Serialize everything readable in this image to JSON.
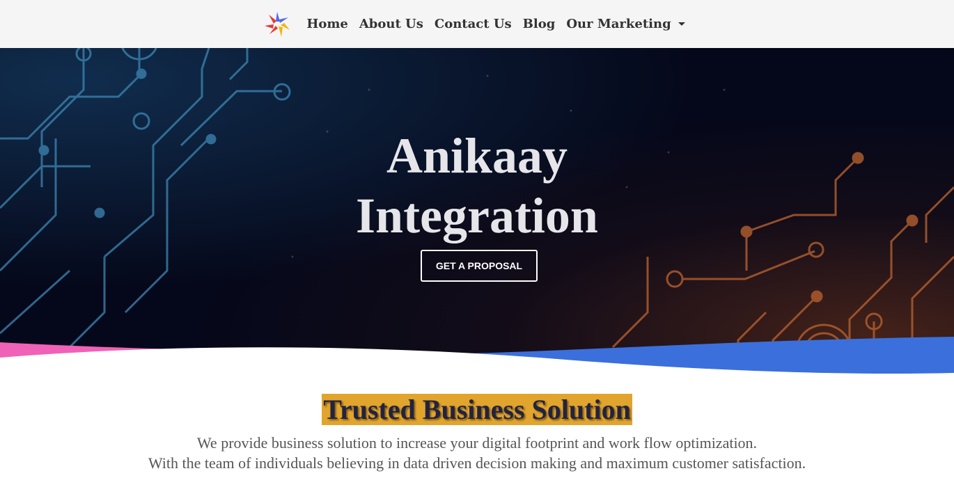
{
  "nav": {
    "logo_alt": "Anikaay logo",
    "items": [
      {
        "label": "Home"
      },
      {
        "label": "About Us"
      },
      {
        "label": "Contact Us"
      },
      {
        "label": "Blog"
      },
      {
        "label": "Our Marketing"
      }
    ]
  },
  "hero": {
    "title_line1": "Anikaay",
    "title_line2": "Integration",
    "cta_label": "GET A PROPOSAL"
  },
  "section": {
    "title": "Trusted Business Solution",
    "line1": "We provide business solution to increase your digital footprint and work flow optimization.",
    "line2": "With the team of individuals believing in data driven decision making and maximum customer satisfaction."
  },
  "colors": {
    "nav_bg": "#f5f5f5",
    "hero_bg": "#05081a",
    "circuit_blue": "#3d86b3",
    "circuit_orange": "#b45f2f",
    "wave_pink": "#f062b8",
    "wave_blue": "#3b6fdc",
    "highlight": "#e1a42c"
  }
}
